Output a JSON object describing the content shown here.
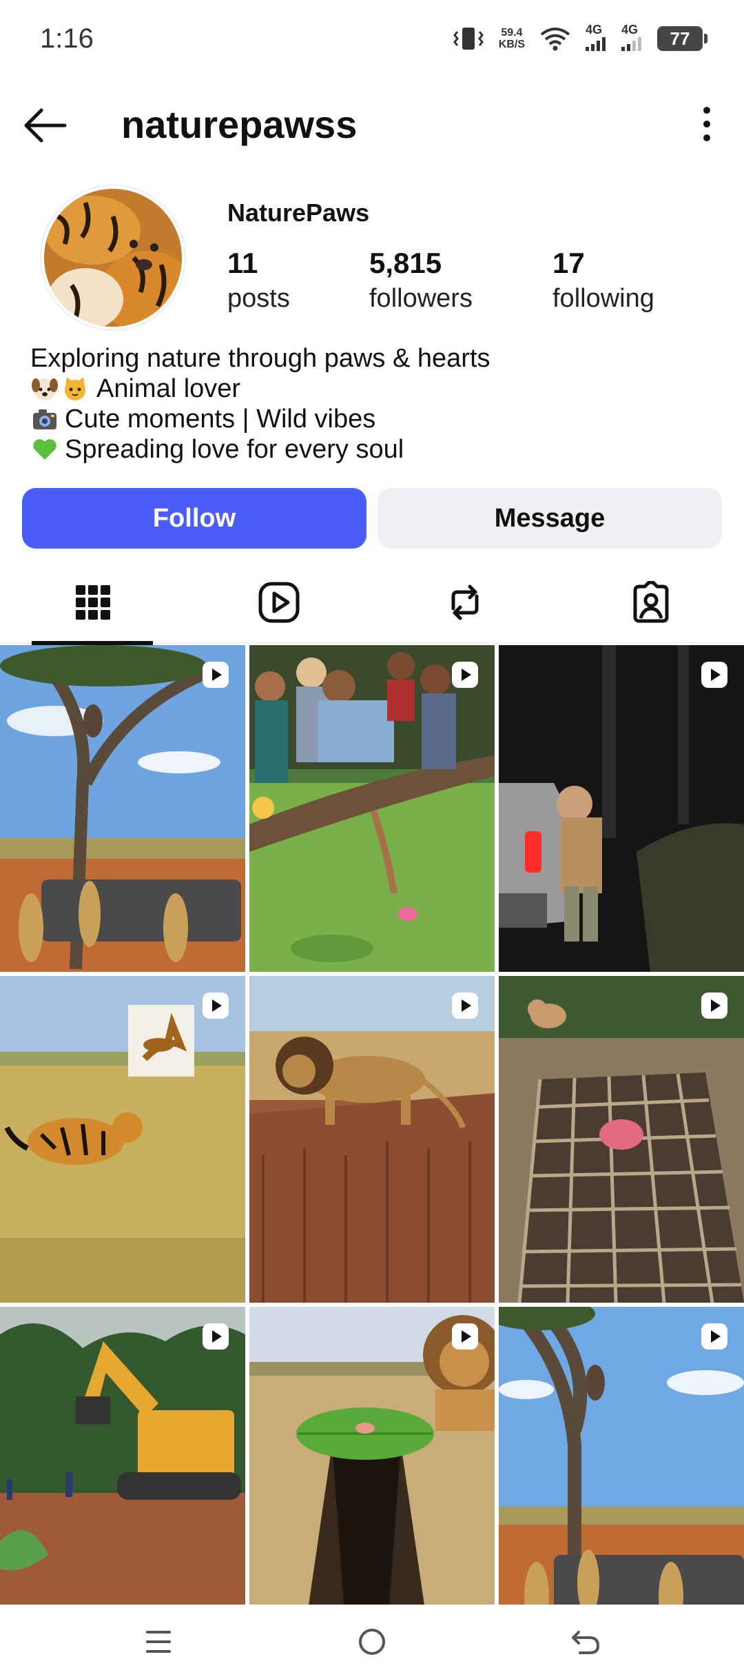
{
  "status_bar": {
    "time": "1:16",
    "speed_value": "59.4",
    "speed_unit": "KB/S",
    "net1": "4G",
    "net2": "4G",
    "battery": "77"
  },
  "header": {
    "username": "naturepawss"
  },
  "profile": {
    "display_name": "NaturePaws",
    "stats": [
      {
        "value": "11",
        "label": "posts"
      },
      {
        "value": "5,815",
        "label": "followers"
      },
      {
        "value": "17",
        "label": "following"
      }
    ],
    "bio": [
      {
        "icon": "",
        "text": "Exploring nature through paws & hearts"
      },
      {
        "icon": "dog-cat-emoji",
        "text": "Animal lover"
      },
      {
        "icon": "camera-emoji",
        "text": "Cute moments | Wild vibes"
      },
      {
        "icon": "green-heart-emoji",
        "text": "Spreading love for every soul"
      }
    ]
  },
  "actions": {
    "follow": "Follow",
    "message": "Message"
  },
  "colors": {
    "follow_button": "#4a5df9",
    "message_button": "#eef0f3"
  },
  "grid": {
    "posts": [
      {
        "name": "post-tree-leopards",
        "reel": true
      },
      {
        "name": "post-boat-lotus",
        "reel": true
      },
      {
        "name": "post-night-car",
        "reel": true
      },
      {
        "name": "post-tiger-antelope-sign",
        "reel": true
      },
      {
        "name": "post-lion-rock",
        "reel": true
      },
      {
        "name": "post-tiger-cage-pit",
        "reel": true
      },
      {
        "name": "post-excavator",
        "reel": true
      },
      {
        "name": "post-lion-leaf-pit",
        "reel": true
      },
      {
        "name": "post-tree-trampoline",
        "reel": true
      }
    ]
  }
}
